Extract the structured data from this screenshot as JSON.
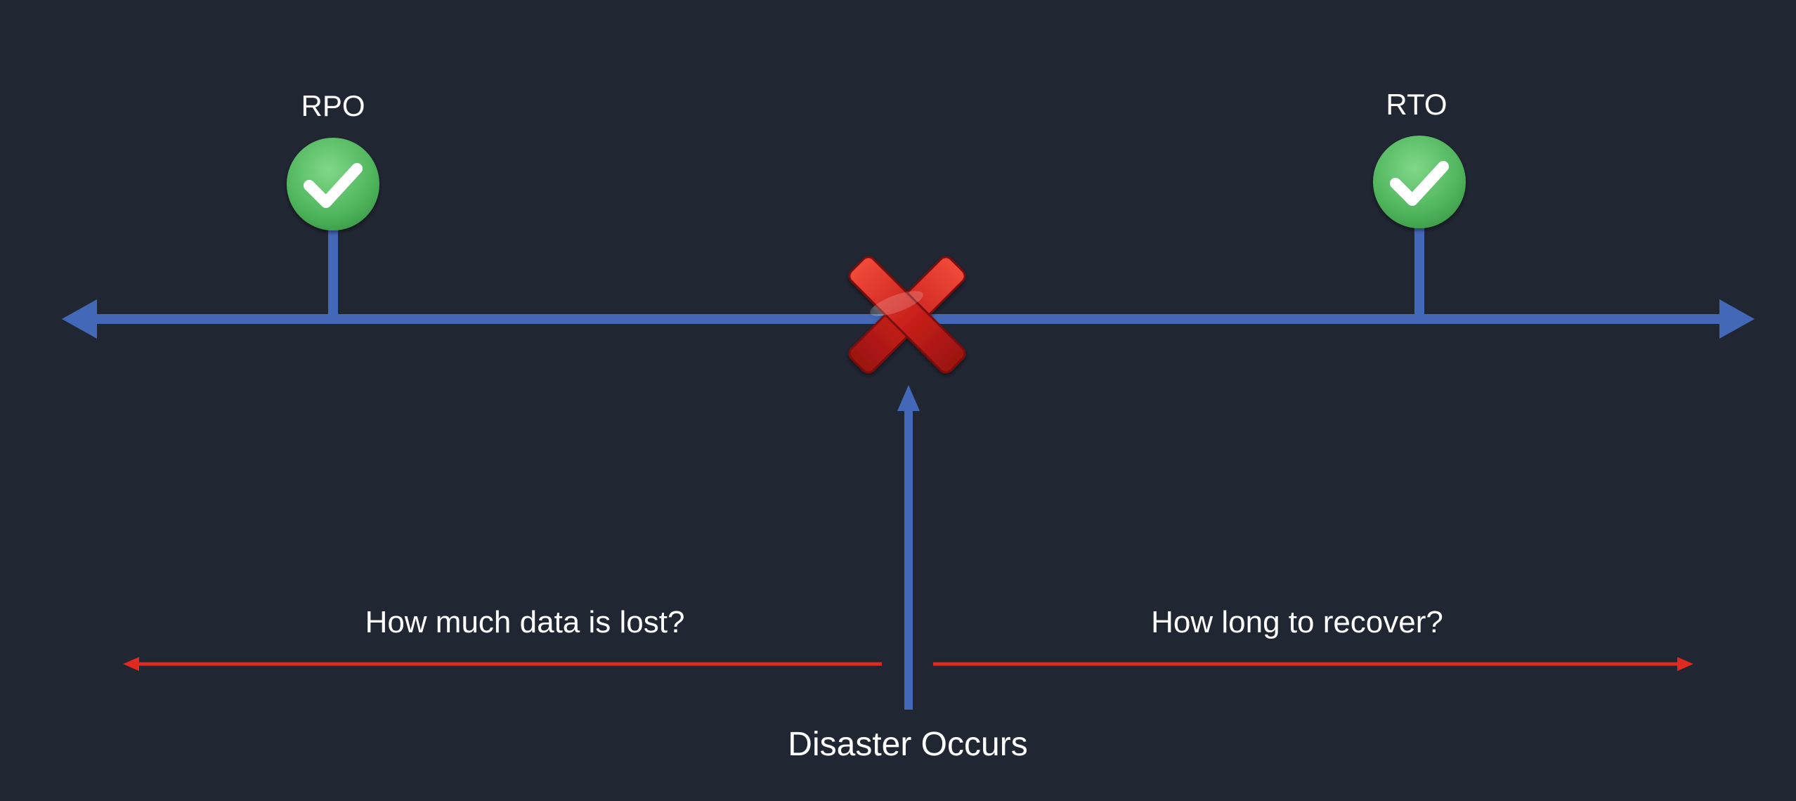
{
  "diagram": {
    "left_marker": {
      "label": "RPO",
      "icon": "check-circle-icon"
    },
    "right_marker": {
      "label": "RTO",
      "icon": "check-circle-icon"
    },
    "event": {
      "label": "Disaster Occurs",
      "icon": "red-x-icon"
    },
    "left_span_label": "How much data is lost?",
    "right_span_label": "How long to recover?"
  },
  "colors": {
    "background": "#212633",
    "timeline": "#4468b8",
    "span_arrows": "#e0291f",
    "check_green": "#5ec26a",
    "x_red": "#cc1f1f",
    "text": "#ffffff"
  }
}
